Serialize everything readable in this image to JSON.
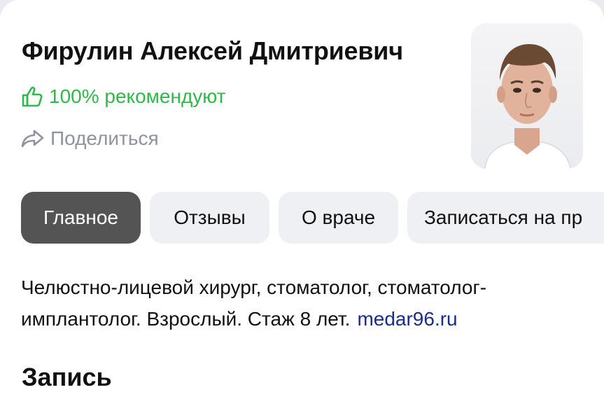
{
  "doctor": {
    "name": "Фирулин Алексей Дмитриевич",
    "recommend_text": "100% рекомендуют",
    "share_label": "Поделиться"
  },
  "tabs": [
    {
      "label": "Главное",
      "active": true
    },
    {
      "label": "Отзывы",
      "active": false
    },
    {
      "label": "О враче",
      "active": false
    },
    {
      "label": "Записаться на пр",
      "active": false
    }
  ],
  "description": {
    "text": "Челюстно-лицевой хирург, стоматолог, стоматолог-имплантолог. Взрослый. Стаж 8 лет.",
    "link": "medar96.ru"
  },
  "section_title": "Запись",
  "colors": {
    "recommend_green": "#2fb84c",
    "share_gray": "#8e939c",
    "active_tab": "#545454",
    "tab_bg": "#eef0f3",
    "link_blue": "#1a2c8c"
  },
  "icons": {
    "recommend": "thumbs-up-icon",
    "share": "share-arrow-icon",
    "photo": "doctor-avatar"
  }
}
